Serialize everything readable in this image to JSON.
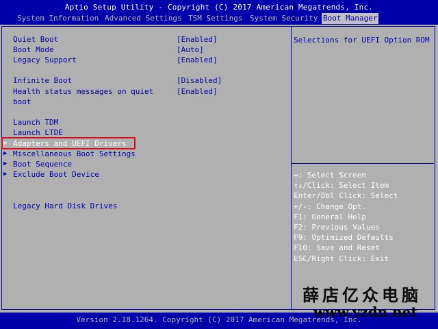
{
  "title": "Aptio Setup Utility - Copyright (C) 2017 American Megatrends, Inc.",
  "tabs": [
    {
      "label": "System Information"
    },
    {
      "label": "Advanced Settings"
    },
    {
      "label": "TSM Settings"
    },
    {
      "label": "System Security"
    },
    {
      "label": "Boot Manager"
    }
  ],
  "settings": [
    {
      "label": "Quiet Boot",
      "value": "[Enabled]"
    },
    {
      "label": "Boot Mode",
      "value": "[Auto]"
    },
    {
      "label": "Legacy Support",
      "value": "[Enabled]"
    },
    {
      "label": "Infinite Boot",
      "value": "[Disabled]"
    },
    {
      "label": "Health status messages on quiet",
      "label2": "boot",
      "value": "[Enabled]"
    },
    {
      "label": "Launch TDM"
    },
    {
      "label": "Launch LTDE"
    }
  ],
  "submenus": [
    {
      "label": "Adapters and UEFI Drivers"
    },
    {
      "label": "Miscellaneous Boot Settings"
    },
    {
      "label": "Boot Sequence"
    },
    {
      "label": "Exclude Boot Device"
    }
  ],
  "legacy_item": {
    "label": "Legacy Hard Disk Drives"
  },
  "submenu_arrow": "▶",
  "help": {
    "text": "Selections for UEFI Option ROM"
  },
  "keys": [
    "↔: Select Screen",
    "↑↓/Click: Select Item",
    "Enter/Dbl Click: Select",
    "+/-: Change Opt.",
    "F1: General Help",
    "F2: Previous Values",
    "F9: Optimized Defaults",
    "F10: Save and Reset",
    "ESC/Right Click: Exit"
  ],
  "footer": "Version 2.18.1264. Copyright (C) 2017 American Megatrends, Inc.",
  "watermark": {
    "line1": "薛店亿众电脑",
    "line2": "www.yzdn.net"
  },
  "colors": {
    "bios_blue": "#0000aa",
    "panel_gray": "#b0b0b0",
    "highlight_red": "#d01020"
  }
}
